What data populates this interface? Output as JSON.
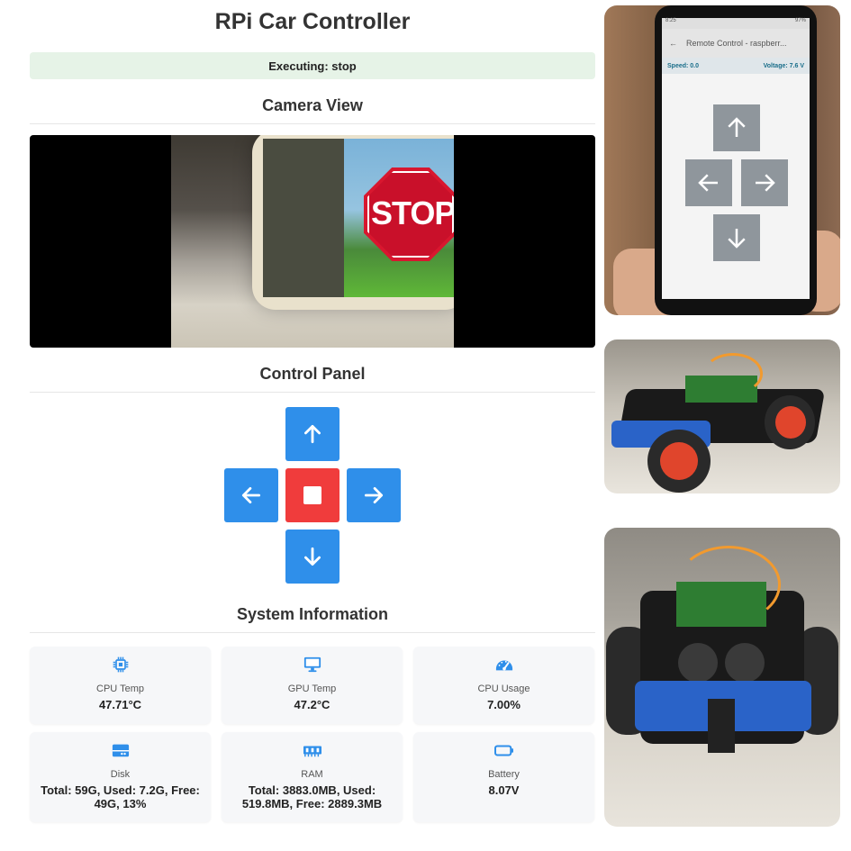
{
  "app": {
    "title": "RPi Car Controller",
    "status": "Executing: stop"
  },
  "sections": {
    "camera": "Camera View",
    "control": "Control Panel",
    "system": "System Information"
  },
  "camera_feed": {
    "sign_text": "STOP"
  },
  "controls": {
    "up_icon": "arrow-up-icon",
    "down_icon": "arrow-down-icon",
    "left_icon": "arrow-left-icon",
    "right_icon": "arrow-right-icon",
    "stop_icon": "stop-square-icon",
    "accent": "#2f8fea",
    "stop_color": "#f03c3c"
  },
  "system_info": {
    "cpu_temp": {
      "label": "CPU Temp",
      "value": "47.71°C",
      "icon": "cpu-icon"
    },
    "gpu_temp": {
      "label": "GPU Temp",
      "value": "47.2°C",
      "icon": "monitor-icon"
    },
    "cpu_usage": {
      "label": "CPU Usage",
      "value": "7.00%",
      "icon": "gauge-icon"
    },
    "disk": {
      "label": "Disk",
      "value": "Total: 59G, Used: 7.2G, Free: 49G, 13%",
      "icon": "hard-drive-icon"
    },
    "ram": {
      "label": "RAM",
      "value": "Total: 3883.0MB, Used: 519.8MB, Free: 2889.3MB",
      "icon": "memory-icon"
    },
    "battery": {
      "label": "Battery",
      "value": "8.07V",
      "icon": "battery-icon"
    }
  },
  "phone_app": {
    "status_time": "8:25",
    "status_battery": "97%",
    "title": "Remote Control - raspberr...",
    "speed": "Speed: 0.0",
    "voltage": "Voltage: 7.6 V"
  }
}
